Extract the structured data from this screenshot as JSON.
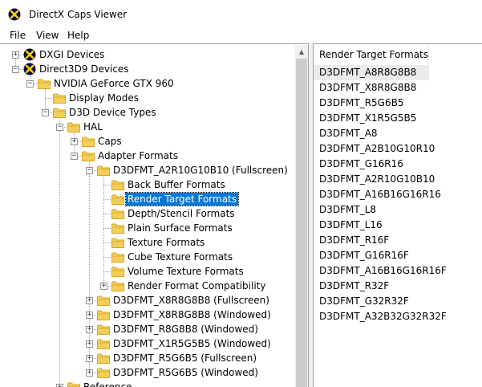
{
  "window": {
    "title": "DirectX Caps Viewer"
  },
  "menu": [
    "File",
    "View",
    "Help"
  ],
  "tree": [
    {
      "label": "DXGI Devices",
      "level": 0,
      "icon": "directx-icon",
      "expander": "+",
      "has_prev": false,
      "has_next": true
    },
    {
      "label": "Direct3D9 Devices",
      "level": 0,
      "icon": "directx-icon",
      "expander": "-",
      "has_prev": true,
      "has_next": false
    },
    {
      "label": "NVIDIA GeForce GTX 960",
      "level": 1,
      "icon": "folder-icon",
      "expander": "-",
      "has_prev": false,
      "has_next": false
    },
    {
      "label": "Display Modes",
      "level": 2,
      "icon": "folder-icon",
      "expander": "",
      "has_prev": false,
      "has_next": true
    },
    {
      "label": "D3D Device Types",
      "level": 2,
      "icon": "folder-icon",
      "expander": "-",
      "has_prev": true,
      "has_next": false
    },
    {
      "label": "HAL",
      "level": 3,
      "icon": "folder-icon",
      "expander": "-",
      "has_prev": false,
      "has_next": true
    },
    {
      "label": "Caps",
      "level": 4,
      "icon": "folder-icon",
      "expander": "+",
      "has_prev": false,
      "has_next": true
    },
    {
      "label": "Adapter Formats",
      "level": 4,
      "icon": "folder-icon",
      "expander": "-",
      "has_prev": true,
      "has_next": false
    },
    {
      "label": "D3DFMT_A2R10G10B10 (Fullscreen)",
      "level": 5,
      "icon": "folder-icon",
      "expander": "-",
      "has_prev": false,
      "has_next": true
    },
    {
      "label": "Back Buffer Formats",
      "level": 6,
      "icon": "folder-icon",
      "expander": "",
      "has_prev": false,
      "has_next": true
    },
    {
      "label": "Render Target Formats",
      "level": 6,
      "icon": "folder-icon",
      "expander": "",
      "selected": true,
      "has_prev": true,
      "has_next": true
    },
    {
      "label": "Depth/Stencil Formats",
      "level": 6,
      "icon": "folder-icon",
      "expander": "",
      "has_prev": true,
      "has_next": true
    },
    {
      "label": "Plain Surface Formats",
      "level": 6,
      "icon": "folder-icon",
      "expander": "",
      "has_prev": true,
      "has_next": true
    },
    {
      "label": "Texture Formats",
      "level": 6,
      "icon": "folder-icon",
      "expander": "",
      "has_prev": true,
      "has_next": true
    },
    {
      "label": "Cube Texture Formats",
      "level": 6,
      "icon": "folder-icon",
      "expander": "",
      "has_prev": true,
      "has_next": true
    },
    {
      "label": "Volume Texture Formats",
      "level": 6,
      "icon": "folder-icon",
      "expander": "",
      "has_prev": true,
      "has_next": true
    },
    {
      "label": "Render Format Compatibility",
      "level": 6,
      "icon": "folder-icon",
      "expander": "+",
      "has_prev": true,
      "has_next": false
    },
    {
      "label": "D3DFMT_X8R8G8B8 (Fullscreen)",
      "level": 5,
      "icon": "folder-icon",
      "expander": "+",
      "has_prev": true,
      "has_next": true
    },
    {
      "label": "D3DFMT_X8R8G8B8 (Windowed)",
      "level": 5,
      "icon": "folder-icon",
      "expander": "+",
      "has_prev": true,
      "has_next": true
    },
    {
      "label": "D3DFMT_R8G8B8 (Windowed)",
      "level": 5,
      "icon": "folder-icon",
      "expander": "+",
      "has_prev": true,
      "has_next": true
    },
    {
      "label": "D3DFMT_X1R5G5B5 (Windowed)",
      "level": 5,
      "icon": "folder-icon",
      "expander": "+",
      "has_prev": true,
      "has_next": true
    },
    {
      "label": "D3DFMT_R5G6B5 (Fullscreen)",
      "level": 5,
      "icon": "folder-icon",
      "expander": "+",
      "has_prev": true,
      "has_next": true
    },
    {
      "label": "D3DFMT_R5G6B5 (Windowed)",
      "level": 5,
      "icon": "folder-icon",
      "expander": "+",
      "has_prev": true,
      "has_next": false
    },
    {
      "label": "Reference",
      "level": 3,
      "icon": "folder-icon",
      "expander": "+",
      "has_prev": true,
      "has_next": false
    }
  ],
  "list": {
    "header": "Render Target Formats",
    "items": [
      "D3DFMT_A8R8G8B8",
      "D3DFMT_X8R8G8B8",
      "D3DFMT_R5G6B5",
      "D3DFMT_X1R5G5B5",
      "D3DFMT_A8",
      "D3DFMT_A2B10G10R10",
      "D3DFMT_G16R16",
      "D3DFMT_A2R10G10B10",
      "D3DFMT_A16B16G16R16",
      "D3DFMT_L8",
      "D3DFMT_L16",
      "D3DFMT_R16F",
      "D3DFMT_G16R16F",
      "D3DFMT_A16B16G16R16F",
      "D3DFMT_R32F",
      "D3DFMT_G32R32F",
      "D3DFMT_A32B32G32R32F"
    ]
  },
  "colors": {
    "selection": "#0078d7",
    "folder": "#f2cf5b",
    "folder_dark": "#d9a520",
    "directx_bg": "#0a0a40",
    "directx_x": "#f5d000"
  }
}
